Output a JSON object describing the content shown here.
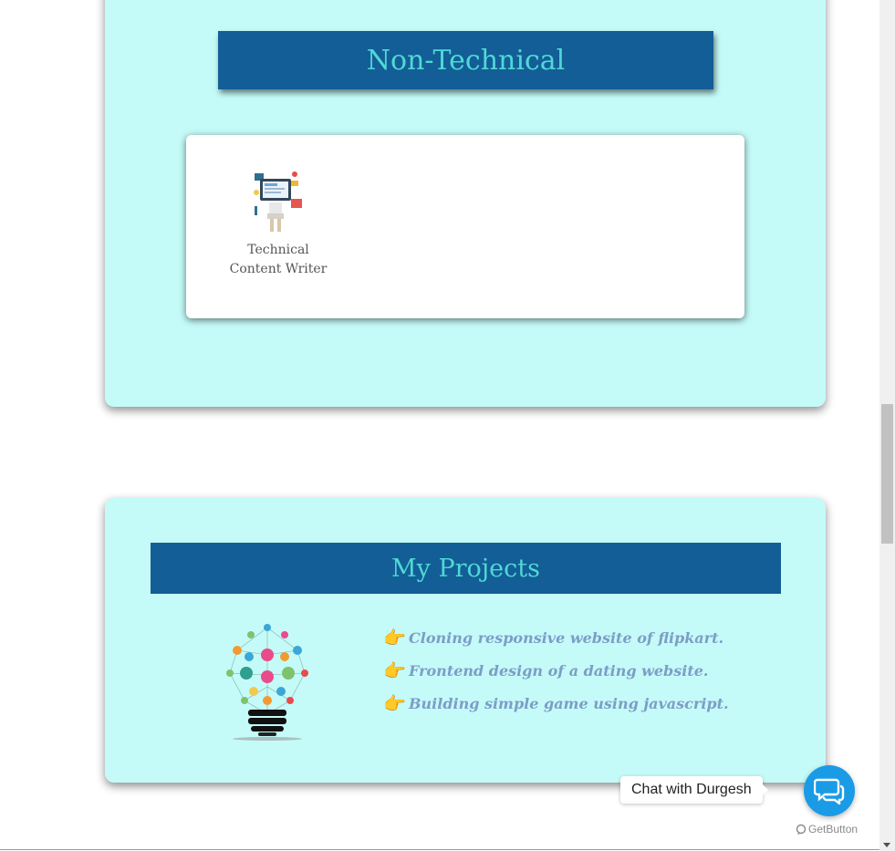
{
  "non_technical": {
    "title": "Non-Technical",
    "skills": [
      {
        "label_line1": "Technical",
        "label_line2": "Content Writer",
        "icon": "content-writer-icon"
      }
    ]
  },
  "projects": {
    "title": "My Projects",
    "icon": "lightbulb-network-icon",
    "items": [
      {
        "bullet": "👉",
        "text": "Cloning responsive website of flipkart."
      },
      {
        "bullet": "👉",
        "text": "Frontend design of a dating website."
      },
      {
        "bullet": "👉",
        "text": "Building simple game using javascript."
      }
    ]
  },
  "chat": {
    "label": "Chat with Durgesh",
    "brand": "GetButton",
    "icon": "chat-bubbles-icon"
  },
  "colors": {
    "card_bg": "#c4fbf8",
    "banner_bg": "#135e96",
    "banner_text": "#4fd8d6",
    "chat_button": "#1a9be6"
  }
}
